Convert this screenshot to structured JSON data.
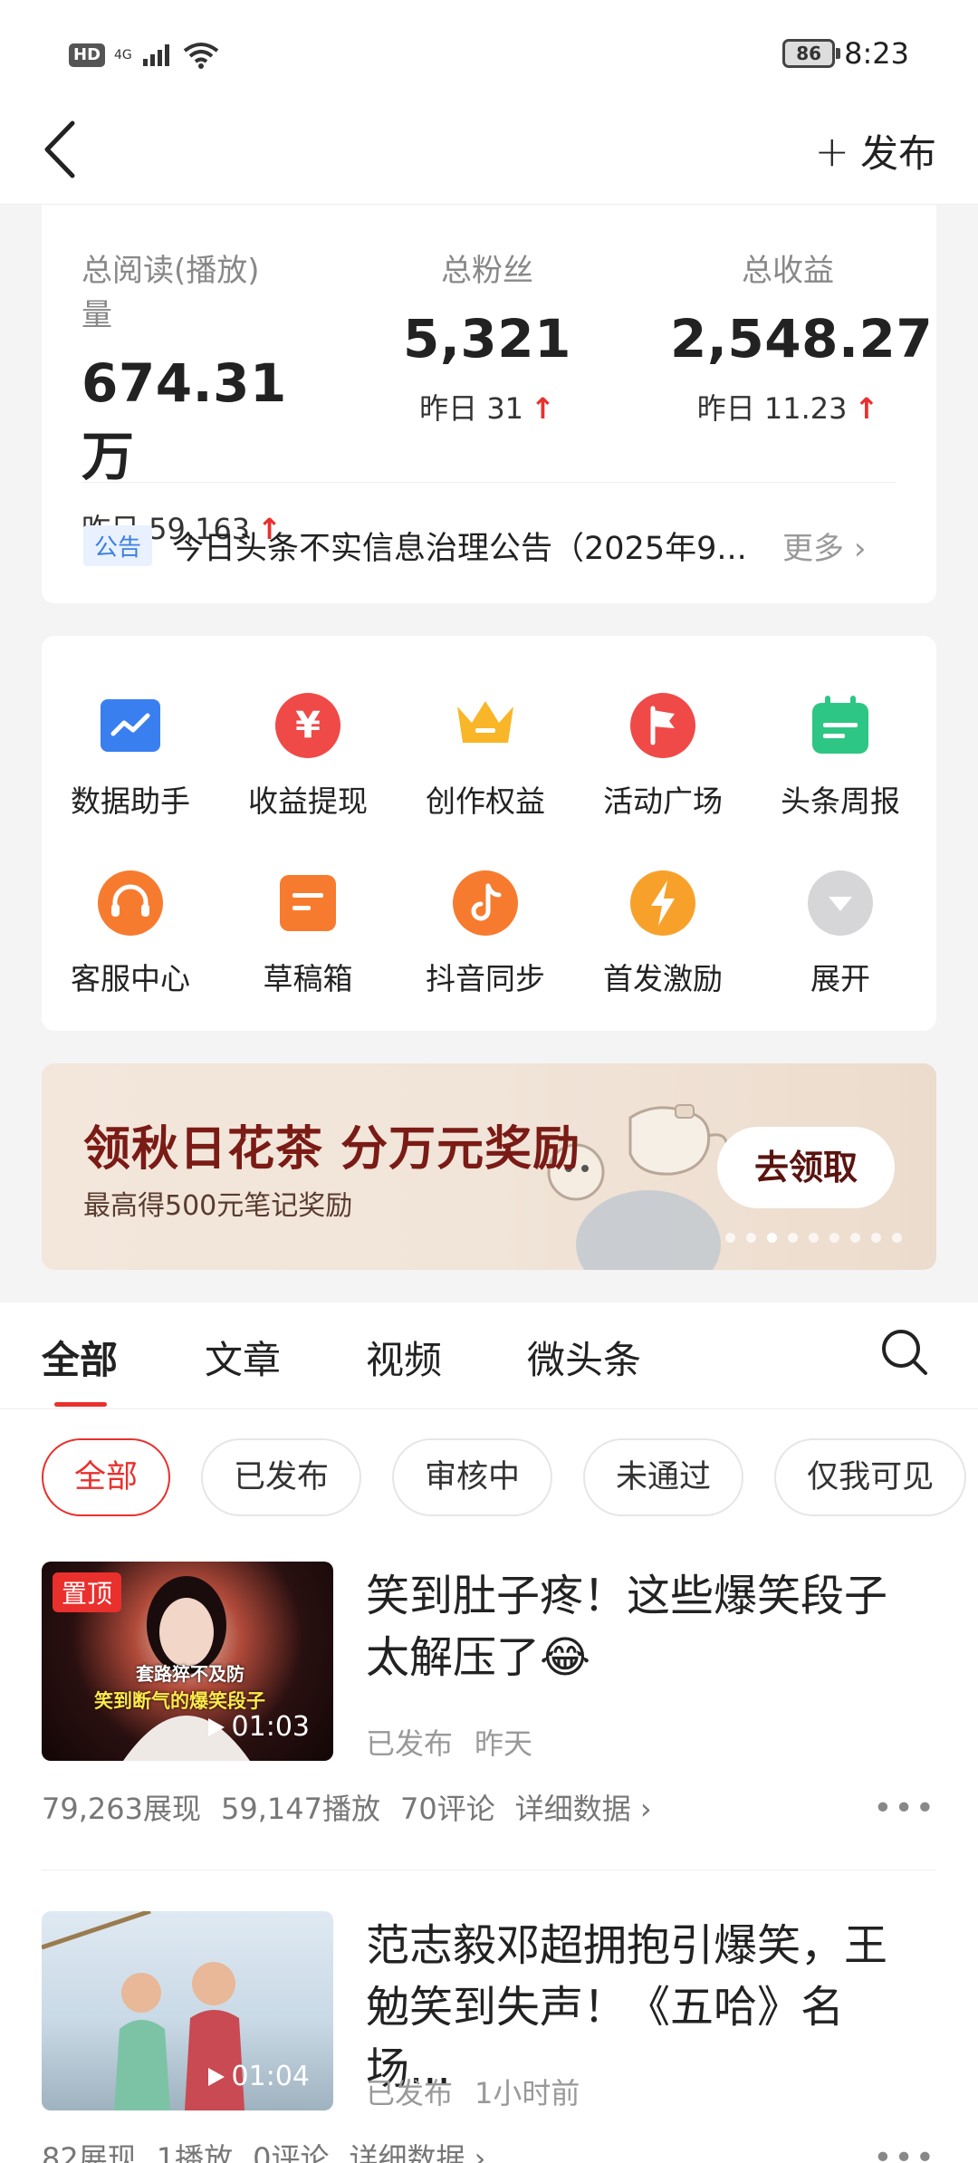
{
  "status_bar": {
    "hd": "HD",
    "network": "4G",
    "battery": "86",
    "time": "8:23"
  },
  "header": {
    "back_label": "",
    "publish_plus": "+",
    "publish_label": "发布"
  },
  "stats": [
    {
      "label": "总阅读(播放)量",
      "value": "674.31万",
      "yesterday": "昨日 59,163"
    },
    {
      "label": "总粉丝",
      "value": "5,321",
      "yesterday": "昨日 31"
    },
    {
      "label": "总收益",
      "value": "2,548.27",
      "yesterday": "昨日 11.23"
    }
  ],
  "notice": {
    "tag": "公告",
    "text": "今日头条不实信息治理公告（2025年9...",
    "more": "更多 ›"
  },
  "tools": [
    {
      "label": "数据助手",
      "icon": "chart-icon"
    },
    {
      "label": "收益提现",
      "icon": "yuan-icon"
    },
    {
      "label": "创作权益",
      "icon": "crown-icon"
    },
    {
      "label": "活动广场",
      "icon": "flag-icon"
    },
    {
      "label": "头条周报",
      "icon": "calendar-icon"
    },
    {
      "label": "客服中心",
      "icon": "headset-icon"
    },
    {
      "label": "草稿箱",
      "icon": "draft-icon"
    },
    {
      "label": "抖音同步",
      "icon": "douyin-icon"
    },
    {
      "label": "首发激励",
      "icon": "lightning-icon"
    },
    {
      "label": "展开",
      "icon": "expand-icon"
    }
  ],
  "banner": {
    "title": "领秋日花茶 分万元奖励",
    "subtitle": "最高得500元笔记奖励",
    "cta": "去领取"
  },
  "tabs": [
    "全部",
    "文章",
    "视频",
    "微头条"
  ],
  "filters": [
    "全部",
    "已发布",
    "审核中",
    "未通过",
    "仅我可见"
  ],
  "items": [
    {
      "pinned": "置顶",
      "thumb_caption_1": "套路猝不及防",
      "thumb_caption_2": "笑到断气的爆笑段子",
      "duration": "01:03",
      "title": "笑到肚子疼！这些爆笑段子太解压了😂",
      "status": "已发布",
      "time": "昨天",
      "impressions": "79,263展现",
      "plays": "59,147播放",
      "comments": "70评论",
      "detail": "详细数据 ›"
    },
    {
      "duration": "01:04",
      "title": "范志毅邓超拥抱引爆笑，王勉笑到失声！《五哈》名场...",
      "status": "已发布",
      "time": "1小时前",
      "impressions": "82展现",
      "plays": "1播放",
      "comments": "0评论",
      "detail": "详细数据 ›"
    }
  ],
  "colors": {
    "accent": "#e9302d",
    "notice_blue": "#3d7fe0"
  }
}
